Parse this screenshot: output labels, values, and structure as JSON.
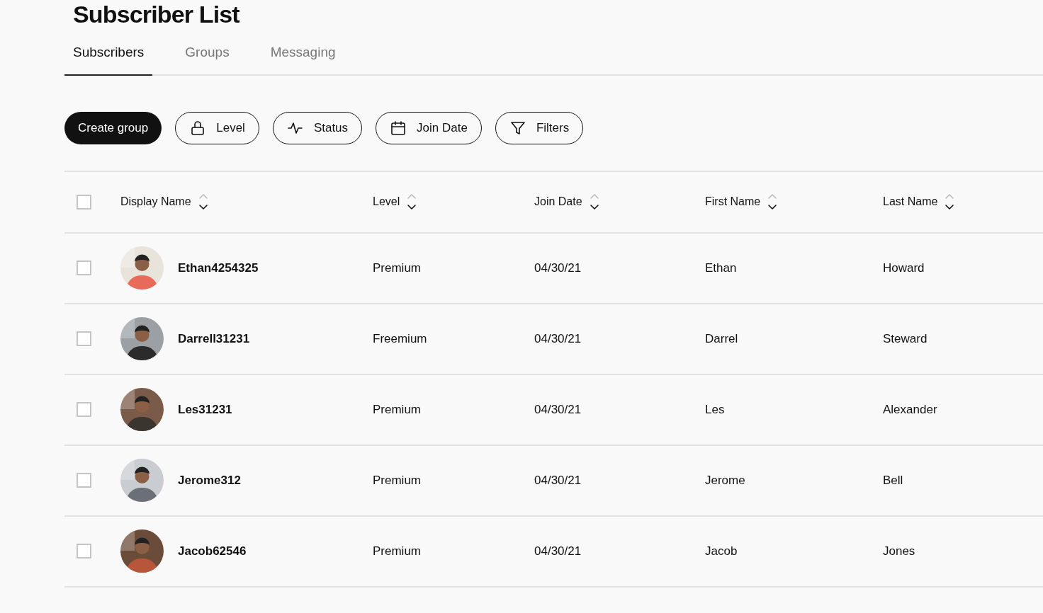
{
  "title": "Subscriber List",
  "tabs": [
    {
      "label": "Subscribers",
      "selected": true
    },
    {
      "label": "Groups",
      "selected": false
    },
    {
      "label": "Messaging",
      "selected": false
    }
  ],
  "toolbar": [
    {
      "kind": "primary",
      "label": "Create group"
    },
    {
      "kind": "lock",
      "label": "Level"
    },
    {
      "kind": "pulse",
      "label": "Status"
    },
    {
      "kind": "calendar",
      "label": "Join Date"
    },
    {
      "kind": "filter",
      "label": "Filters"
    }
  ],
  "table": {
    "select_all_checked": false,
    "columns": [
      "Display Name",
      "Level",
      "Join Date",
      "First Name",
      "Last Name"
    ],
    "rows": [
      {
        "checked": false,
        "display_name": "Ethan4254325",
        "level": "Premium",
        "join_date": "04/30/21",
        "first_name": "Ethan",
        "last_name": "Howard"
      },
      {
        "checked": false,
        "display_name": "Darrell31231",
        "level": "Freemium",
        "join_date": "04/30/21",
        "first_name": "Darrel",
        "last_name": "Steward"
      },
      {
        "checked": false,
        "display_name": "Les31231",
        "level": "Premium",
        "join_date": "04/30/21",
        "first_name": "Les",
        "last_name": "Alexander"
      },
      {
        "checked": false,
        "display_name": "Jerome312",
        "level": "Premium",
        "join_date": "04/30/21",
        "first_name": "Jerome",
        "last_name": "Bell"
      },
      {
        "checked": false,
        "display_name": "Jacob62546",
        "level": "Premium",
        "join_date": "04/30/21",
        "first_name": "Jacob",
        "last_name": "Jones"
      }
    ]
  }
}
